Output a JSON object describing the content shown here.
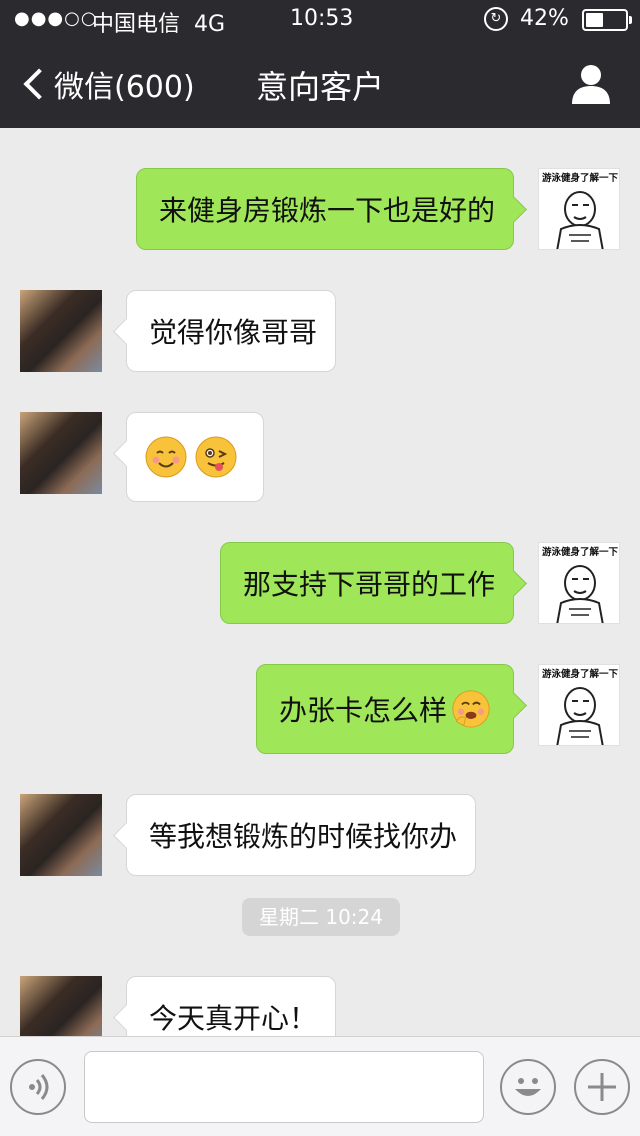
{
  "status_bar": {
    "signal_dots": "●●●○○",
    "carrier": "中国电信",
    "network": "4G",
    "time": "10:53",
    "battery_percent": "42%",
    "battery_level": 0.42,
    "orientation_lock_icon": "orientation-lock-icon"
  },
  "nav": {
    "back_label": "微信(600)",
    "title": "意向客户",
    "profile_icon": "person-icon"
  },
  "colors": {
    "nav_background": "#2b2a2f",
    "chat_background": "#ebebeb",
    "outgoing_bubble": "#9fe658",
    "incoming_bubble": "#ffffff"
  },
  "messages": [
    {
      "direction": "out",
      "text": "来健身房锻炼一下也是好的"
    },
    {
      "direction": "in",
      "text": "觉得你像哥哥"
    },
    {
      "direction": "in",
      "emoji": [
        "smile-blush-emoji",
        "wink-tongue-emoji"
      ]
    },
    {
      "direction": "out",
      "text": "那支持下哥哥的工作"
    },
    {
      "direction": "out",
      "text": "办张卡怎么样",
      "emoji": [
        "giggle-emoji"
      ]
    },
    {
      "direction": "in",
      "text": "等我想锻炼的时候找你办"
    },
    {
      "direction": "in",
      "text": "今天真开心！"
    }
  ],
  "timestamp_divider": "星期二 10:24",
  "meme_avatar_caption": "游泳健身了解一下",
  "input_bar": {
    "voice_icon": "voice-icon",
    "text_value": "",
    "emoji_icon": "emoji-icon",
    "more_icon": "plus-icon"
  }
}
